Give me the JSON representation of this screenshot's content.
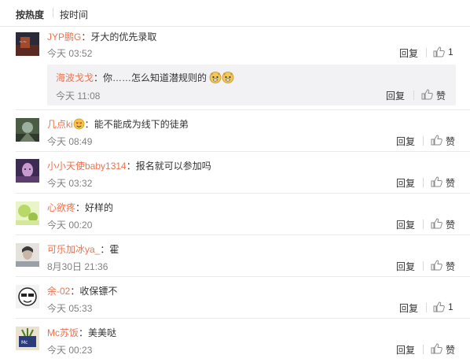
{
  "sort": {
    "hot_label": "按热度",
    "time_label": "按时间"
  },
  "comments": [
    {
      "user": "JYP鹏G",
      "text": "牙大的优先录取",
      "time": "今天 03:52",
      "reply_label": "回复",
      "like_text": "1",
      "avatar_colors": [
        "#2a2a38",
        "#a04a2e"
      ]
    },
    {
      "user": "几点ki",
      "text": "能不能成为线下的徒弟",
      "time": "今天 08:49",
      "reply_label": "回复",
      "like_text": "赞",
      "avatar_colors": [
        "#4b5e45",
        "#9db0a0"
      ]
    },
    {
      "user": "小小天使baby1314",
      "text": "报名就可以参加吗",
      "time": "今天 03:32",
      "reply_label": "回复",
      "like_text": "赞",
      "avatar_colors": [
        "#3c2b52",
        "#c89ad0"
      ]
    },
    {
      "user": "心欲疼",
      "text": "好样的",
      "time": "今天 00:20",
      "reply_label": "回复",
      "like_text": "赞",
      "avatar_colors": [
        "#b8d86a",
        "#e9f5c8"
      ]
    },
    {
      "user": "可乐加冰ya_",
      "text": "霍",
      "time": "8月30日 21:36",
      "reply_label": "回复",
      "like_text": "赞",
      "avatar_colors": [
        "#9aa0a8",
        "#e5e2de"
      ]
    },
    {
      "user": "余-02",
      "text": "收保镖不",
      "time": "今天 05:33",
      "reply_label": "回复",
      "like_text": "1",
      "avatar_colors": [
        "#f3f3f3",
        "#222222"
      ]
    },
    {
      "user": "Mc苏饭",
      "text": "美美哒",
      "time": "今天 00:23",
      "reply_label": "回复",
      "like_text": "赞",
      "avatar_colors": [
        "#e8e2cf",
        "#2a3a7a"
      ]
    }
  ],
  "subreply": {
    "user": "海波戈戈",
    "text": "你……怎么知道潜规则的",
    "time": "今天 11:08",
    "reply_label": "回复",
    "like_text": "赞",
    "emoji": "doge-face"
  },
  "user_box_emoji": "love-eyes-face",
  "colors": {
    "username": "#eb7350",
    "time": "#808080",
    "divider": "#eaeaea",
    "subreply_bg": "#f2f2f5"
  },
  "icons": {
    "like": "thumb-up-icon"
  }
}
